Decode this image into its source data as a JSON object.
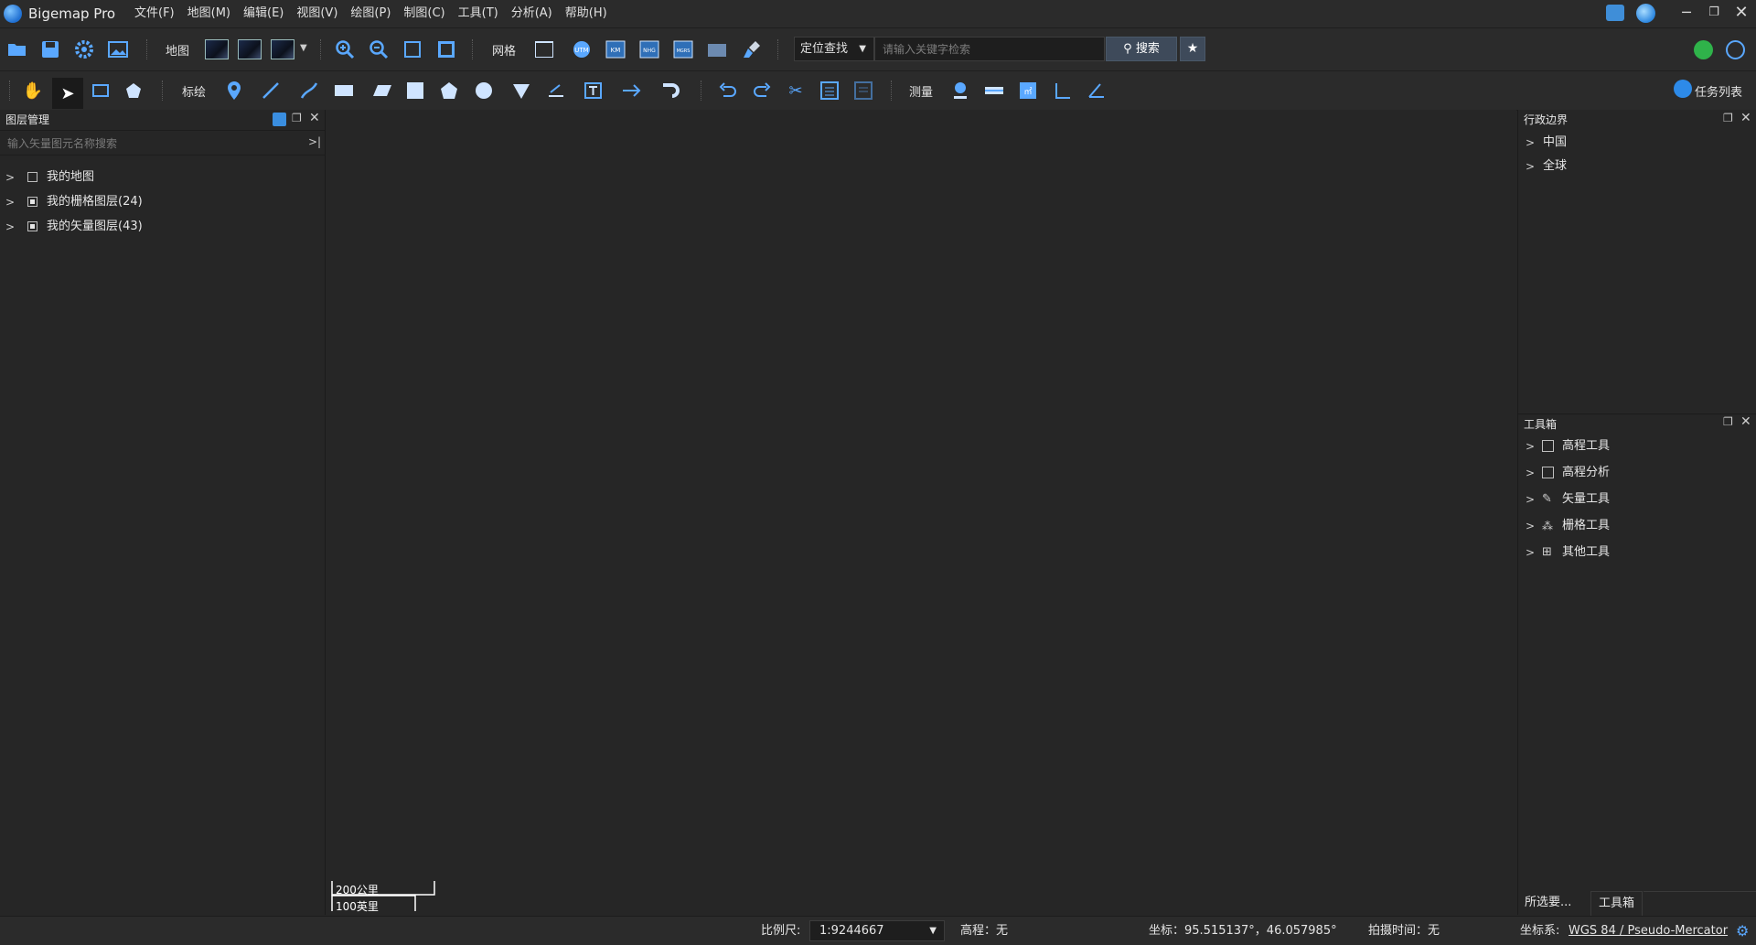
{
  "app": {
    "title": "Bigemap Pro"
  },
  "menu": [
    "文件(F)",
    "地图(M)",
    "编辑(E)",
    "视图(V)",
    "绘图(P)",
    "制图(C)",
    "工具(T)",
    "分析(A)",
    "帮助(H)"
  ],
  "toolbar1": {
    "map_label": "地图",
    "grid_label": "网格",
    "search_type": "定位查找",
    "search_placeholder": "请输入关键字检索",
    "search_button": "搜索",
    "grid_icons": [
      "UTM",
      "KM",
      "NHG",
      "MGRS"
    ]
  },
  "toolbar2": {
    "draw_label": "标绘",
    "measure_label": "测量",
    "task_list": "任务列表"
  },
  "left_panel": {
    "title": "图层管理",
    "search_placeholder": "输入矢量图元名称搜索",
    "layers": [
      {
        "label": "我的地图",
        "checked": "unchecked"
      },
      {
        "label": "我的栅格图层(24)",
        "checked": "partial"
      },
      {
        "label": "我的矢量图层(43)",
        "checked": "partial"
      }
    ]
  },
  "right_panel": {
    "admin": {
      "title": "行政边界",
      "items": [
        "中国",
        "全球"
      ]
    },
    "toolbox": {
      "title": "工具箱",
      "items": [
        {
          "label": "高程工具",
          "icon": "elevation-icon"
        },
        {
          "label": "高程分析",
          "icon": "elevation-analysis-icon"
        },
        {
          "label": "矢量工具",
          "icon": "pen-icon"
        },
        {
          "label": "栅格工具",
          "icon": "raster-icon"
        },
        {
          "label": "其他工具",
          "icon": "grid-icon"
        }
      ]
    },
    "tabs": [
      "所选要...",
      "工具箱"
    ]
  },
  "scale_bar": {
    "metric": "200公里",
    "imperial": "100英里"
  },
  "status": {
    "scale_label": "比例尺:",
    "scale_value": "1:9244667",
    "elevation": "高程：无",
    "coords": "坐标：95.515137°，46.057985°",
    "capture_time": "拍摄时间：无",
    "crs_label": "坐标系:",
    "crs_value": "WGS 84 / Pseudo-Mercator"
  }
}
